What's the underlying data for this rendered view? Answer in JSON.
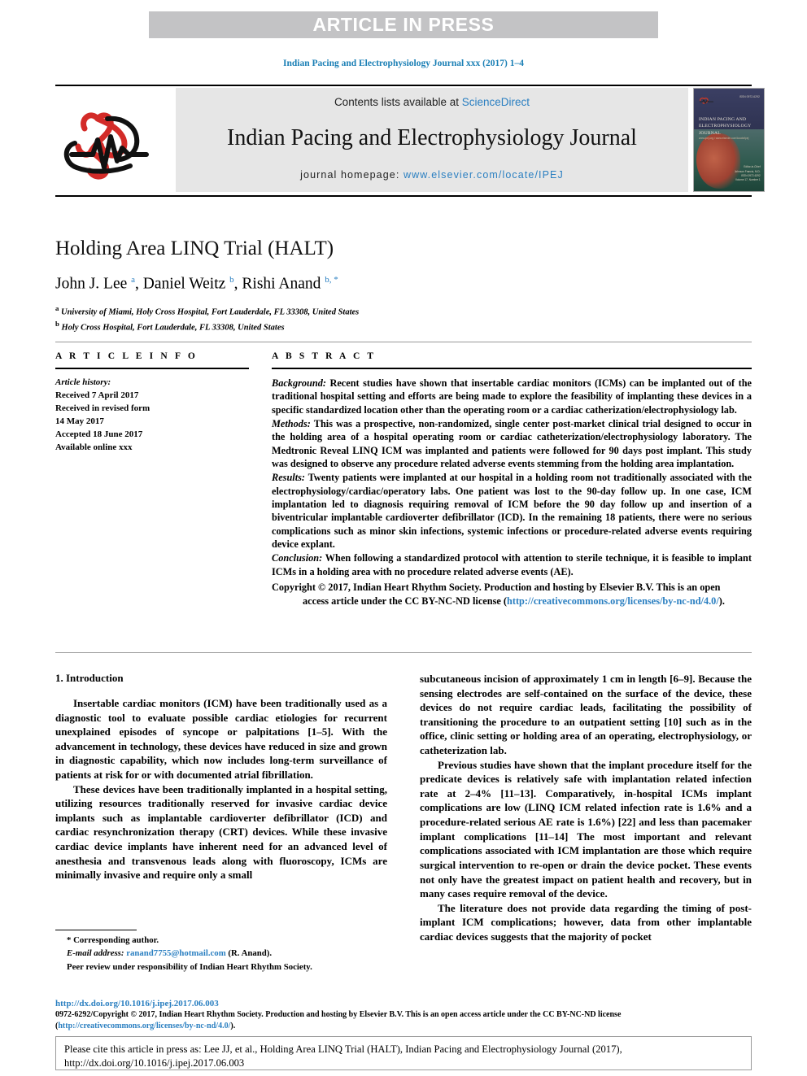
{
  "banner": {
    "text": "ARTICLE IN PRESS"
  },
  "running_head": "Indian Pacing and Electrophysiology Journal xxx (2017) 1–4",
  "masthead": {
    "contents_prefix": "Contents lists available at ",
    "sciencedirect": "ScienceDirect",
    "journal_title": "Indian Pacing and Electrophysiology Journal",
    "homepage_label": "journal homepage: ",
    "homepage_url": "www.elsevier.com/locate/IPEJ",
    "logo_icon": "heart-ecg-logo-icon",
    "cover": {
      "icon": "journal-cover-thumbnail",
      "title_line1": "INDIAN PACING AND",
      "title_line2": "ELECTROPHYSIOLOGY",
      "title_line3": "JOURNAL",
      "subtitle": "www.ipej.org / www.elsevier.com/locate/ipej",
      "badge": "ISSN 0972-6292",
      "footer_line1": "Editor-in-Chief",
      "footer_line2": "Johnson Francis, M.D.",
      "footer_line3": "ISSN 0972-6292",
      "footer_line4": "Volume 17, Number 1"
    }
  },
  "article": {
    "title": "Holding Area LINQ Trial (HALT)",
    "authors_html": "John J. Lee <sup>a</sup>, Daniel Weitz <sup>b</sup>, Rishi Anand <sup>b, *</sup>",
    "authors_plain": "John J. Lee a, Daniel Weitz b, Rishi Anand b, *",
    "affiliation_a": "University of Miami, Holy Cross Hospital, Fort Lauderdale, FL 33308, United States",
    "affiliation_b": "Holy Cross Hospital, Fort Lauderdale, FL 33308, United States"
  },
  "info": {
    "heading": "A R T I C L E   I N F O",
    "history_label": "Article history:",
    "history": [
      "Received 7 April 2017",
      "Received in revised form",
      "14 May 2017",
      "Accepted 18 June 2017",
      "Available online xxx"
    ]
  },
  "abstract": {
    "heading": "A B S T R A C T",
    "background_label": "Background:",
    "background": " Recent studies have shown that insertable cardiac monitors (ICMs) can be implanted out of the traditional hospital setting and efforts are being made to explore the feasibility of implanting these devices in a specific standardized location other than the operating room or a cardiac catherization/electrophysiology lab.",
    "methods_label": "Methods:",
    "methods": " This was a prospective, non-randomized, single center post-market clinical trial designed to occur in the holding area of a hospital operating room or cardiac catheterization/electrophysiology laboratory. The Medtronic Reveal LINQ ICM was implanted and patients were followed for 90 days post implant. This study was designed to observe any procedure related adverse events stemming from the holding area implantation.",
    "results_label": "Results:",
    "results": " Twenty patients were implanted at our hospital in a holding room not traditionally associated with the electrophysiology/cardiac/operatory labs. One patient was lost to the 90-day follow up. In one case, ICM implantation led to diagnosis requiring removal of ICM before the 90 day follow up and insertion of a biventricular implantable cardioverter defibrillator (ICD). In the remaining 18 patients, there were no serious complications such as minor skin infections, systemic infections or procedure-related adverse events requiring device explant.",
    "conclusion_label": "Conclusion:",
    "conclusion": " When following a standardized protocol with attention to sterile technique, it is feasible to implant ICMs in a holding area with no procedure related adverse events (AE).",
    "copyright_1": "Copyright © 2017, Indian Heart Rhythm Society. Production and hosting by Elsevier B.V. This is an open",
    "copyright_2": "access article under the CC BY-NC-ND license (",
    "copyright_link": "http://creativecommons.org/licenses/by-nc-nd/4.0/",
    "copyright_3": ")."
  },
  "body": {
    "section_number_title": "1. Introduction",
    "left_paragraphs": [
      "Insertable cardiac monitors (ICM) have been traditionally used as a diagnostic tool to evaluate possible cardiac etiologies for recurrent unexplained episodes of syncope or palpitations [1–5]. With the advancement in technology, these devices have reduced in size and grown in diagnostic capability, which now includes long-term surveillance of patients at risk for or with documented atrial fibrillation.",
      "These devices have been traditionally implanted in a hospital setting, utilizing resources traditionally reserved for invasive cardiac device implants such as implantable cardioverter defibrillator (ICD) and cardiac resynchronization therapy (CRT) devices. While these invasive cardiac device implants have inherent need for an advanced level of anesthesia and transvenous leads along with fluoroscopy, ICMs are minimally invasive and require only a small"
    ],
    "right_paragraphs": [
      "subcutaneous incision of approximately 1 cm in length [6–9]. Because the sensing electrodes are self-contained on the surface of the device, these devices do not require cardiac leads, facilitating the possibility of transitioning the procedure to an outpatient setting [10] such as in the office, clinic setting or holding area of an operating, electrophysiology, or catheterization lab.",
      "Previous studies have shown that the implant procedure itself for the predicate devices is relatively safe with implantation related infection rate at 2–4% [11–13]. Comparatively, in-hospital ICMs implant complications are low (LINQ ICM related infection rate is 1.6% and a procedure-related serious AE rate is 1.6%) [22] and less than pacemaker implant complications [11–14] The most important and relevant complications associated with ICM implantation are those which require surgical intervention to re-open or drain the device pocket. These events not only have the greatest impact on patient health and recovery, but in many cases require removal of the device.",
      "The literature does not provide data regarding the timing of post-implant ICM complications; however, data from other implantable cardiac devices suggests that the majority of pocket"
    ]
  },
  "footnotes": {
    "corresponding": "* Corresponding author.",
    "email_label": "E-mail address:",
    "email": "ranand7755@hotmail.com",
    "email_suffix": " (R. Anand).",
    "peer_review": "Peer review under responsibility of Indian Heart Rhythm Society."
  },
  "bottom": {
    "doi": "http://dx.doi.org/10.1016/j.ipej.2017.06.003",
    "copyright_text_1": "0972-6292/Copyright © 2017, Indian Heart Rhythm Society. Production and hosting by Elsevier B.V. This is an open access article under the CC BY-NC-ND license (",
    "copyright_link": "http://creativecommons.org/licenses/by-nc-nd/4.0/",
    "copyright_text_2": ")."
  },
  "cite_box": {
    "text": "Please cite this article in press as: Lee JJ, et al., Holding Area LINQ Trial (HALT), Indian Pacing and Electrophysiology Journal (2017), http://dx.doi.org/10.1016/j.ipej.2017.06.003"
  },
  "colors": {
    "link": "#2a7fc1",
    "banner_bg": "#c3c3c5",
    "masthead_bg": "#e6e6e6",
    "logo_red": "#d32b28"
  }
}
